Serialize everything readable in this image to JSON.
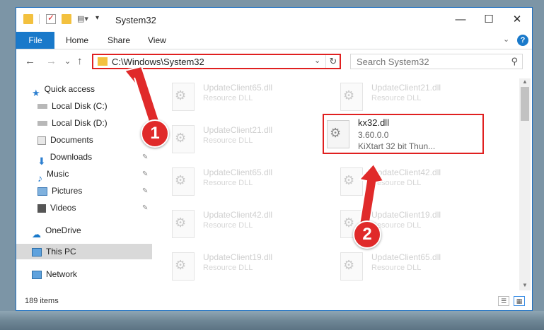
{
  "window": {
    "title": "System32",
    "minimize_glyph": "—",
    "maximize_glyph": "☐",
    "close_glyph": "✕"
  },
  "ribbon": {
    "tabs": [
      "File",
      "Home",
      "Share",
      "View"
    ],
    "help_glyph": "?",
    "collapse_glyph": "⌄"
  },
  "nav": {
    "back_glyph": "←",
    "forward_glyph": "→",
    "recent_glyph": "⌄",
    "up_glyph": "↑",
    "address_path": "C:\\Windows\\System32",
    "address_drop_glyph": "⌄",
    "refresh_glyph": "↻",
    "search_placeholder": "Search System32",
    "search_glyph": "⚲"
  },
  "sidebar": {
    "items": [
      {
        "label": "Quick access",
        "icon": "star-icon"
      },
      {
        "label": "Local Disk (C:)",
        "icon": "drive-icon"
      },
      {
        "label": "Local Disk (D:)",
        "icon": "drive-icon"
      },
      {
        "label": "Documents",
        "icon": "documents-icon"
      },
      {
        "label": "Downloads",
        "icon": "download-icon"
      },
      {
        "label": "Music",
        "icon": "music-icon"
      },
      {
        "label": "Pictures",
        "icon": "pictures-icon"
      },
      {
        "label": "Videos",
        "icon": "videos-icon"
      },
      {
        "label": "OneDrive",
        "icon": "cloud-icon"
      },
      {
        "label": "This PC",
        "icon": "computer-icon"
      },
      {
        "label": "Network",
        "icon": "network-icon"
      }
    ],
    "pin_glyph": "✎"
  },
  "files": [
    {
      "name": "UpdateClient65.dll",
      "desc": "Resource DLL"
    },
    {
      "name": "UpdateClient21.dll",
      "desc": "Resource DLL"
    },
    {
      "name": "UpdateClient21.dll",
      "desc": "Resource DLL"
    },
    {
      "name": "UpdateClient65.dll",
      "desc": "Resource DLL"
    },
    {
      "name": "UpdateClient42.dll",
      "desc": "Resource DLL"
    },
    {
      "name": "UpdateClient42.dll",
      "desc": "Resource DLL"
    },
    {
      "name": "UpdateClient19.dll",
      "desc": "Resource DLL"
    },
    {
      "name": "UpdateClient19.dll",
      "desc": "Resource DLL"
    },
    {
      "name": "UpdateClient65.dll",
      "desc": "Resource DLL"
    }
  ],
  "highlighted_file": {
    "name": "kx32.dll",
    "version": "3.60.0.0",
    "description": "KiXtart 32 bit Thun..."
  },
  "status": {
    "item_count": "189 items"
  },
  "annotations": {
    "step1": "1",
    "step2": "2",
    "highlight_color": "#e02020"
  },
  "colors": {
    "accent": "#1979ca",
    "annotation_red": "#e02a2a"
  }
}
